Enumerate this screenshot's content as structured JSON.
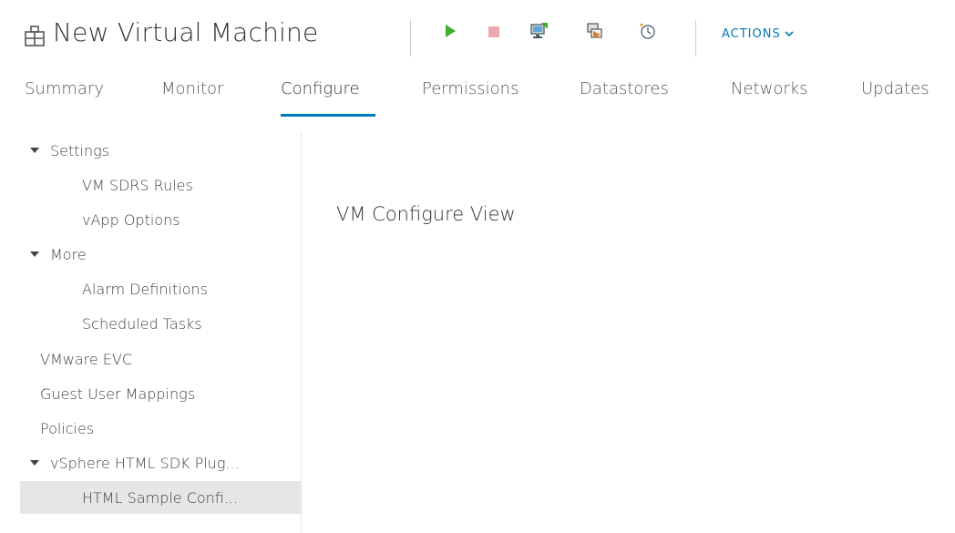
{
  "header": {
    "title": "New Virtual Machine",
    "actions_label": "ACTIONS",
    "toolbar": [
      {
        "icon": "power-on-icon"
      },
      {
        "icon": "power-off-icon"
      },
      {
        "icon": "launch-console-icon"
      },
      {
        "icon": "migrate-icon"
      },
      {
        "icon": "snapshot-icon"
      }
    ]
  },
  "tabs": [
    {
      "label": "Summary"
    },
    {
      "label": "Monitor"
    },
    {
      "label": "Configure",
      "active": true
    },
    {
      "label": "Permissions"
    },
    {
      "label": "Datastores"
    },
    {
      "label": "Networks"
    },
    {
      "label": "Updates"
    }
  ],
  "sidebar": {
    "items": [
      {
        "label": "Settings",
        "expandable": true
      },
      {
        "label": "VM SDRS Rules"
      },
      {
        "label": "vApp Options"
      },
      {
        "label": "More",
        "expandable": true
      },
      {
        "label": "Alarm Definitions"
      },
      {
        "label": "Scheduled Tasks"
      },
      {
        "label": "VMware EVC"
      },
      {
        "label": "Guest User Mappings"
      },
      {
        "label": "Policies"
      },
      {
        "label": "vSphere HTML SDK Plug...",
        "expandable": true
      },
      {
        "label": "HTML Sample Confi...",
        "selected": true
      }
    ]
  },
  "main": {
    "title": "VM Configure View"
  },
  "colors": {
    "accent": "#0079b8",
    "play_green": "#3fae29",
    "stop_pink": "#f0a8b0",
    "selected_bg": "#e6e6e6"
  }
}
